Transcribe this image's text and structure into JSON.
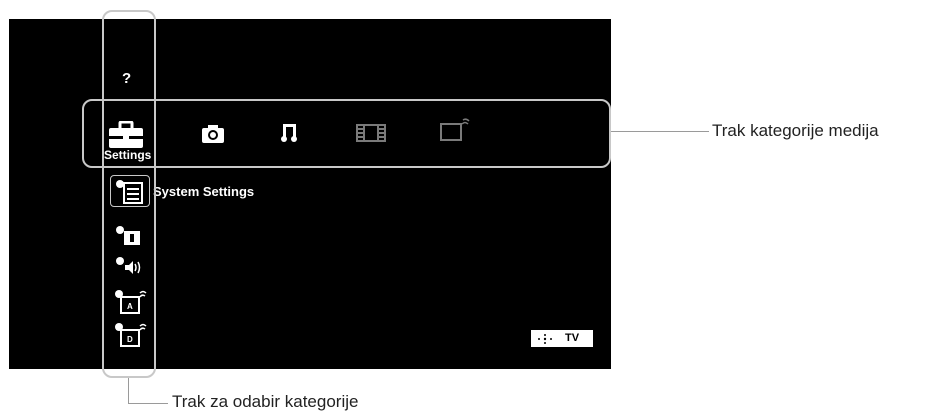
{
  "menu": {
    "help_glyph": "?",
    "selected_category": "Settings",
    "selected_item": "System Settings"
  },
  "media_bar": {
    "items": [
      {
        "icon": "settings-toolbox-icon",
        "label": "Settings",
        "selected": true
      },
      {
        "icon": "photo-camera-icon",
        "label": ""
      },
      {
        "icon": "music-note-icon",
        "label": ""
      },
      {
        "icon": "video-film-icon",
        "label": ""
      },
      {
        "icon": "tv-input-icon",
        "label": ""
      }
    ]
  },
  "category_bar": {
    "items": [
      {
        "icon": "system-settings-icon",
        "selected": true
      },
      {
        "icon": "picture-settings-icon"
      },
      {
        "icon": "sound-settings-icon"
      },
      {
        "icon": "analog-channel-settings-icon"
      },
      {
        "icon": "digital-channel-settings-icon"
      }
    ],
    "sub_glyphs": {
      "analog": "A",
      "digital": "D"
    }
  },
  "status": {
    "source": "TV"
  },
  "callouts": {
    "media_bar": "Trak kategorije medija",
    "category_bar": "Trak za odabir kategorije"
  },
  "colors": {
    "screen": "#000000",
    "icon": "#ffffff",
    "icon_dim": "#7a7a7a",
    "frame": "#c8c8c8"
  }
}
